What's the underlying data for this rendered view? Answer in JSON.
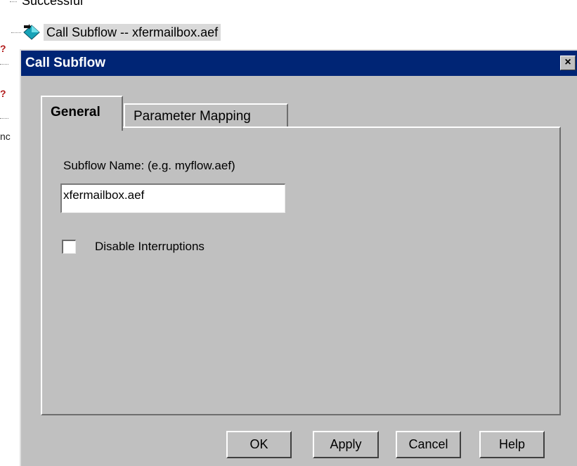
{
  "tree": {
    "top_partial_label": "Successful",
    "selected_item_label": "Call Subflow -- xfermailbox.aef",
    "left_fragment": "nc"
  },
  "dialog": {
    "title": "Call Subflow",
    "close_glyph": "×",
    "tabs": [
      {
        "label": "General",
        "active": true
      },
      {
        "label": "Parameter Mapping",
        "active": false
      }
    ],
    "subflow_name_label": "Subflow Name: (e.g. myflow.aef)",
    "subflow_name_value": "xfermailbox.aef",
    "disable_interruptions_label": "Disable Interruptions",
    "disable_interruptions_checked": false,
    "buttons": {
      "ok": "OK",
      "apply": "Apply",
      "cancel": "Cancel",
      "help": "Help"
    }
  },
  "colors": {
    "title_bar": "#002575",
    "dialog_face": "#c0c0c0",
    "selection_highlight": "#d9d9d9"
  },
  "icons": {
    "tree_item": "subflow-icon",
    "close": "close-icon"
  }
}
